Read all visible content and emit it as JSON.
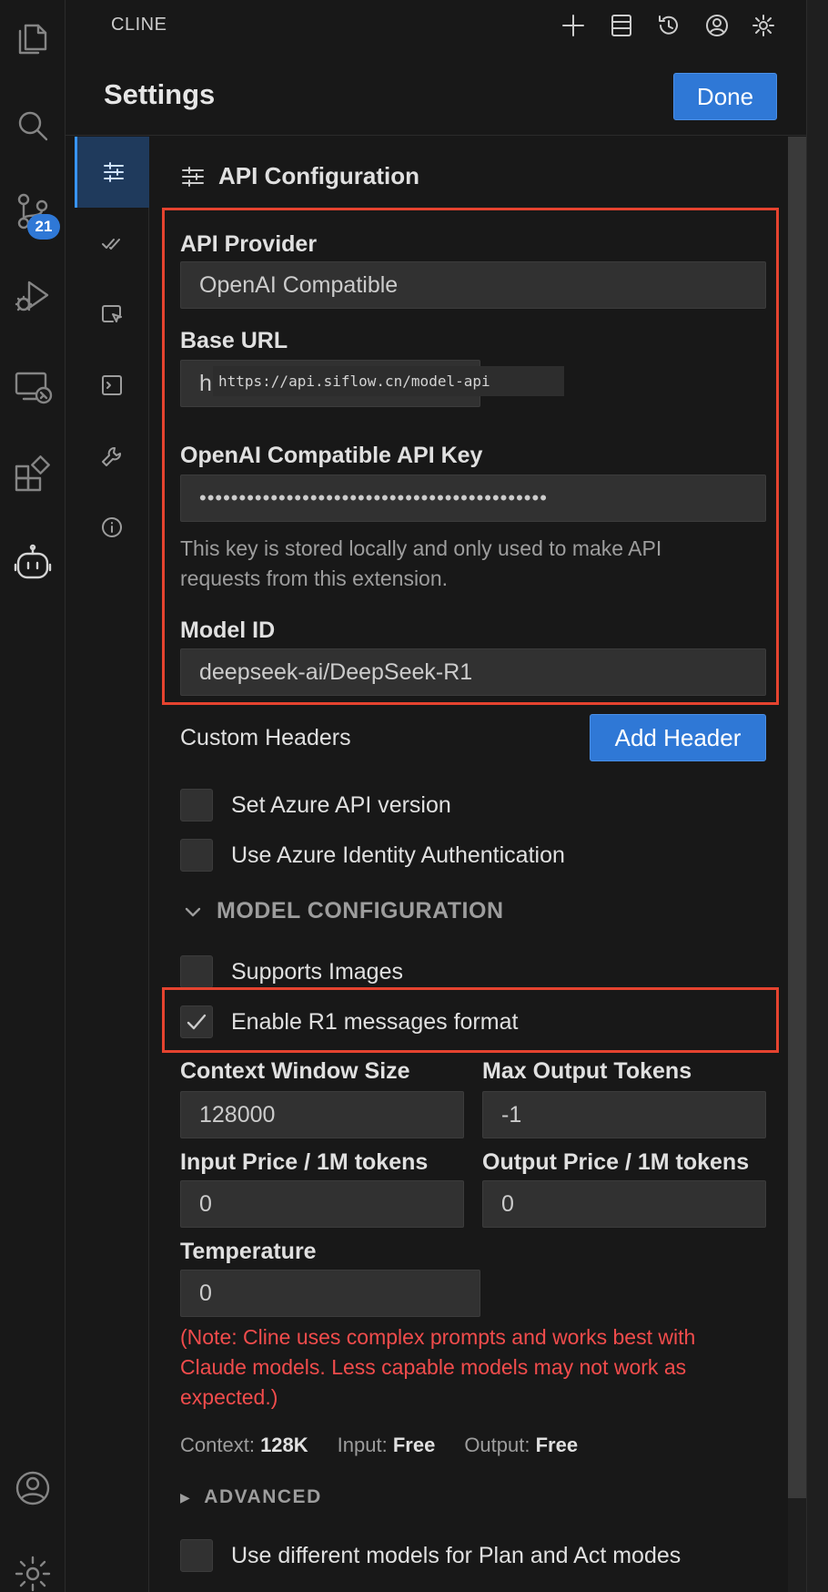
{
  "panel": {
    "title": "CLINE",
    "header_icons": [
      "plus-icon",
      "database-icon",
      "history-icon",
      "account-icon",
      "gear-icon"
    ]
  },
  "activity_bar": {
    "items": [
      "explorer-icon",
      "search-icon",
      "source-control-icon",
      "run-debug-icon",
      "remote-explorer-icon",
      "extensions-icon",
      "cline-icon",
      "accounts-icon",
      "manage-gear-icon"
    ],
    "source_control_badge": "21"
  },
  "settings": {
    "title": "Settings",
    "done_label": "Done",
    "tabs": [
      "api-config-icon",
      "checks-icon",
      "browser-icon",
      "terminal-icon",
      "tools-icon",
      "info-icon"
    ]
  },
  "api": {
    "section_title": "API Configuration",
    "provider_label": "API Provider",
    "provider_value": "OpenAI Compatible",
    "base_url_label": "Base URL",
    "base_url_value": "h",
    "base_url_tooltip": "https://api.siflow.cn/model-api",
    "api_key_label": "OpenAI Compatible API Key",
    "api_key_value": "••••••••••••••••••••••••••••••••••••••••••••",
    "api_key_help": "This key is stored locally and only used to make API requests from this extension.",
    "model_id_label": "Model ID",
    "model_id_value": "deepseek-ai/DeepSeek-R1"
  },
  "custom_headers": {
    "label": "Custom Headers",
    "add_label": "Add Header"
  },
  "azure": {
    "api_version_label": "Set Azure API version",
    "identity_label": "Use Azure Identity Authentication"
  },
  "model_config": {
    "section_label": "MODEL CONFIGURATION",
    "supports_images_label": "Supports Images",
    "r1_format_label": "Enable R1 messages format",
    "r1_format_checked": true,
    "context_window_label": "Context Window Size",
    "context_window_value": "128000",
    "max_output_label": "Max Output Tokens",
    "max_output_value": "-1",
    "input_price_label": "Input Price / 1M tokens",
    "input_price_value": "0",
    "output_price_label": "Output Price / 1M tokens",
    "output_price_value": "0",
    "temperature_label": "Temperature",
    "temperature_value": "0",
    "warning": "(Note: Cline uses complex prompts and works best with Claude models. Less capable models may not work as expected.)"
  },
  "model_info": {
    "context_label": "Context:",
    "context_value": "128K",
    "input_label": "Input:",
    "input_value": "Free",
    "output_label": "Output:",
    "output_value": "Free"
  },
  "advanced": {
    "label": "ADVANCED",
    "plan_act_label": "Use different models for Plan and Act modes"
  },
  "colors": {
    "accent": "#2f78d6",
    "highlight_border": "#e5432f",
    "warning_text": "#f14c4c",
    "background": "#181818"
  }
}
